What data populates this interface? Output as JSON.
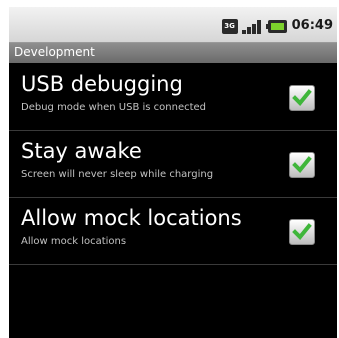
{
  "status_bar": {
    "network_label": "3G",
    "time": "06:49",
    "battery_color": "#7cd12c",
    "icons": [
      "3g-icon",
      "signal-icon",
      "battery-icon"
    ]
  },
  "title_bar": {
    "title": "Development"
  },
  "preferences": [
    {
      "title": "USB debugging",
      "summary": "Debug mode when USB is connected",
      "checked": true
    },
    {
      "title": "Stay awake",
      "summary": "Screen will never sleep while charging",
      "checked": true
    },
    {
      "title": "Allow mock locations",
      "summary": "Allow mock locations",
      "checked": true
    }
  ],
  "colors": {
    "check_green": "#3fb63a",
    "background": "#000000"
  }
}
